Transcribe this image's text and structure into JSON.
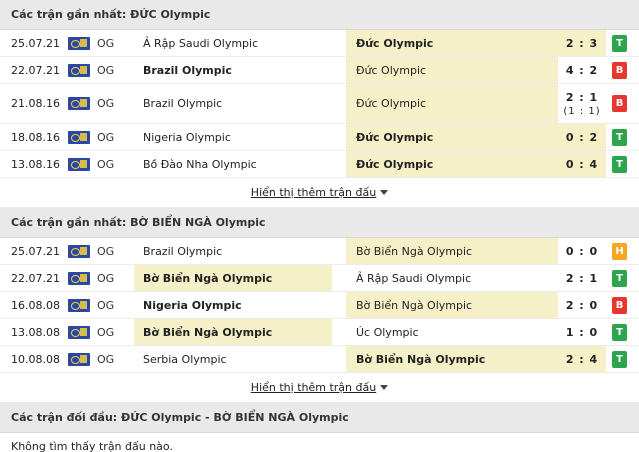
{
  "colors": {
    "win": "#2ea44f",
    "loss": "#e8352e",
    "draw": "#f5a623",
    "highlight": "#f6f0c8"
  },
  "sections": [
    {
      "title": "Các trận gần nhất: ĐỨC Olympic",
      "rows": [
        {
          "date": "25.07.21",
          "comp": "OG",
          "home": "Ả Rập Saudi Olympic",
          "away": "Đức Olympic",
          "score": "2 : 3",
          "sub": "",
          "res": "T"
        },
        {
          "date": "22.07.21",
          "comp": "OG",
          "home": "Brazil Olympic",
          "away": "Đức Olympic",
          "score": "4 : 2",
          "sub": "",
          "res": "B"
        },
        {
          "date": "21.08.16",
          "comp": "OG",
          "home": "Brazil Olympic",
          "away": "Đức Olympic",
          "score": "2 : 1",
          "sub": "(1 : 1)",
          "res": "B"
        },
        {
          "date": "18.08.16",
          "comp": "OG",
          "home": "Nigeria Olympic",
          "away": "Đức Olympic",
          "score": "0 : 2",
          "sub": "",
          "res": "T"
        },
        {
          "date": "13.08.16",
          "comp": "OG",
          "home": "Bồ Đào Nha Olympic",
          "away": "Đức Olympic",
          "score": "0 : 4",
          "sub": "",
          "res": "T"
        }
      ],
      "more": "Hiển thị thêm trận đấu"
    },
    {
      "title": "Các trận gần nhất: BỜ BIỂN NGÀ Olympic",
      "rows": [
        {
          "date": "25.07.21",
          "comp": "OG",
          "home": "Brazil Olympic",
          "away": "Bờ Biển Ngà Olympic",
          "score": "0 : 0",
          "sub": "",
          "res": "H"
        },
        {
          "date": "22.07.21",
          "comp": "OG",
          "home": "Bờ Biển Ngà Olympic",
          "away": "Ả Rập Saudi Olympic",
          "score": "2 : 1",
          "sub": "",
          "res": "T"
        },
        {
          "date": "16.08.08",
          "comp": "OG",
          "home": "Nigeria Olympic",
          "away": "Bờ Biển Ngà Olympic",
          "score": "2 : 0",
          "sub": "",
          "res": "B"
        },
        {
          "date": "13.08.08",
          "comp": "OG",
          "home": "Bờ Biển Ngà Olympic",
          "away": "Úc Olympic",
          "score": "1 : 0",
          "sub": "",
          "res": "T"
        },
        {
          "date": "10.08.08",
          "comp": "OG",
          "home": "Serbia Olympic",
          "away": "Bờ Biển Ngà Olympic",
          "score": "2 : 4",
          "sub": "",
          "res": "T"
        }
      ],
      "more": "Hiển thị thêm trận đấu"
    }
  ],
  "h2h": {
    "title": "Các trận đối đầu: ĐỨC Olympic - BỜ BIỂN NGÀ Olympic",
    "empty": "Không tìm thấy trận đấu nào."
  }
}
